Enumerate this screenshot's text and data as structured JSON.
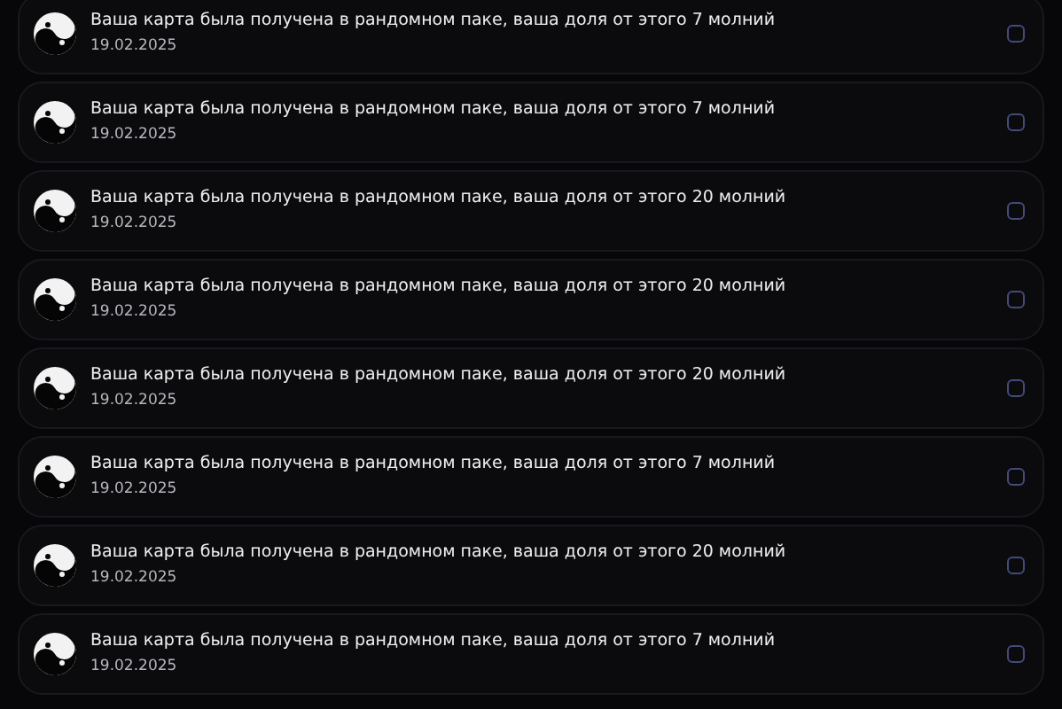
{
  "notifications": [
    {
      "message": "Ваша карта была получена в рандомном паке, ваша доля от этого 7 молний",
      "date": "19.02.2025",
      "checked": false
    },
    {
      "message": "Ваша карта была получена в рандомном паке, ваша доля от этого 7 молний",
      "date": "19.02.2025",
      "checked": false
    },
    {
      "message": "Ваша карта была получена в рандомном паке, ваша доля от этого 20 молний",
      "date": "19.02.2025",
      "checked": false
    },
    {
      "message": "Ваша карта была получена в рандомном паке, ваша доля от этого 20 молний",
      "date": "19.02.2025",
      "checked": false
    },
    {
      "message": "Ваша карта была получена в рандомном паке, ваша доля от этого 20 молний",
      "date": "19.02.2025",
      "checked": false
    },
    {
      "message": "Ваша карта была получена в рандомном паке, ваша доля от этого 7 молний",
      "date": "19.02.2025",
      "checked": false
    },
    {
      "message": "Ваша карта была получена в рандомном паке, ваша доля от этого 20 молний",
      "date": "19.02.2025",
      "checked": false
    },
    {
      "message": "Ваша карта была получена в рандомном паке, ваша доля от этого 7 молний",
      "date": "19.02.2025",
      "checked": false
    }
  ]
}
